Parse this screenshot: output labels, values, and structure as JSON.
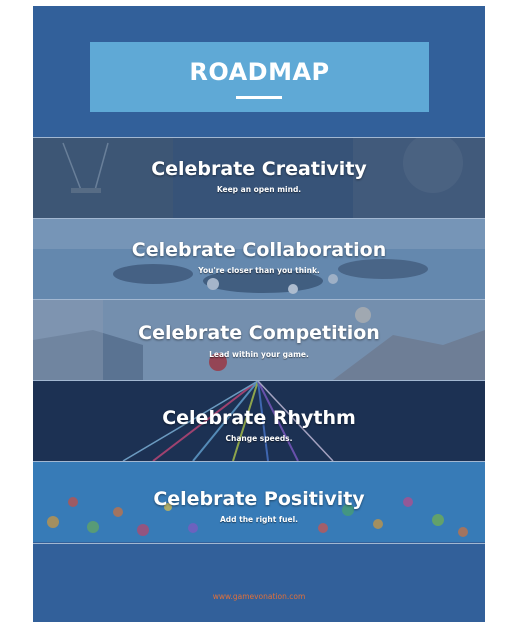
{
  "header": {
    "title": "ROADMAP"
  },
  "bands": [
    {
      "title": "Celebrate Creativity",
      "subtitle": "Keep an open mind."
    },
    {
      "title": "Celebrate Collaboration",
      "subtitle": "You're closer than you think."
    },
    {
      "title": "Celebrate Competition",
      "subtitle": "Lead within your game."
    },
    {
      "title": "Celebrate Rhythm",
      "subtitle": "Change speeds."
    },
    {
      "title": "Celebrate Positivity",
      "subtitle": "Add the right fuel."
    }
  ],
  "footer": {
    "url": "www.gamevonation.com"
  },
  "colors": {
    "background": "#32609a",
    "header_box": "#5fa9d6",
    "footer_text": "#e0703a"
  }
}
